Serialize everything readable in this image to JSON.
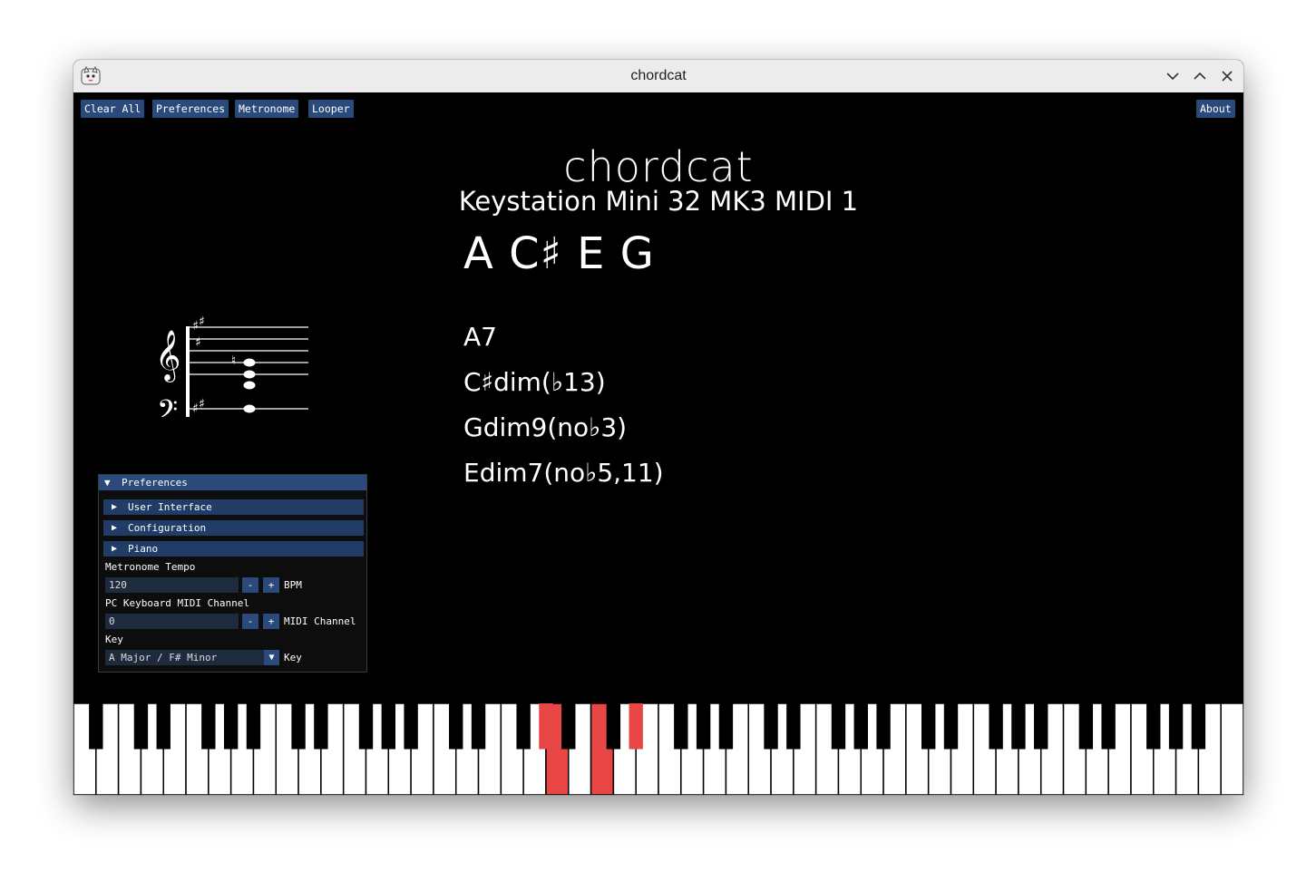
{
  "window": {
    "title": "chordcat"
  },
  "toolbar": {
    "clear_all": "Clear All",
    "preferences": "Preferences",
    "metronome": "Metronome",
    "looper": "Looper",
    "about": "About"
  },
  "main": {
    "title": "chordcat",
    "device": "Keystation Mini 32 MK3 MIDI 1",
    "notes": "A C♯ E G",
    "chords": [
      "A7",
      "C♯dim(♭13)",
      "Gdim9(no♭3)",
      "Edim7(no♭5,11)"
    ]
  },
  "preferences": {
    "header": "Preferences",
    "sections": [
      "User Interface",
      "Configuration",
      "Piano"
    ],
    "tempo_label": "Metronome Tempo",
    "tempo_value": "120",
    "tempo_unit": "BPM",
    "channel_label": "PC Keyboard MIDI Channel",
    "channel_value": "0",
    "channel_unit": "MIDI Channel",
    "key_label": "Key",
    "key_value": "A Major / F# Minor",
    "key_unit": "Key",
    "minus": "-",
    "plus": "+"
  },
  "piano": {
    "white_keys": 52,
    "pressed_white": [
      21,
      23
    ],
    "pressed_black": [
      [
        20,
        21
      ],
      [
        22,
        23
      ],
      [
        24,
        25
      ]
    ],
    "highlight_color": "#e84545"
  },
  "icons": {
    "app": "cat-icon",
    "minimize": "chevron-down-icon",
    "maximize": "chevron-up-icon",
    "close": "close-icon",
    "expand": "triangle-right-icon",
    "collapse": "triangle-down-icon"
  }
}
